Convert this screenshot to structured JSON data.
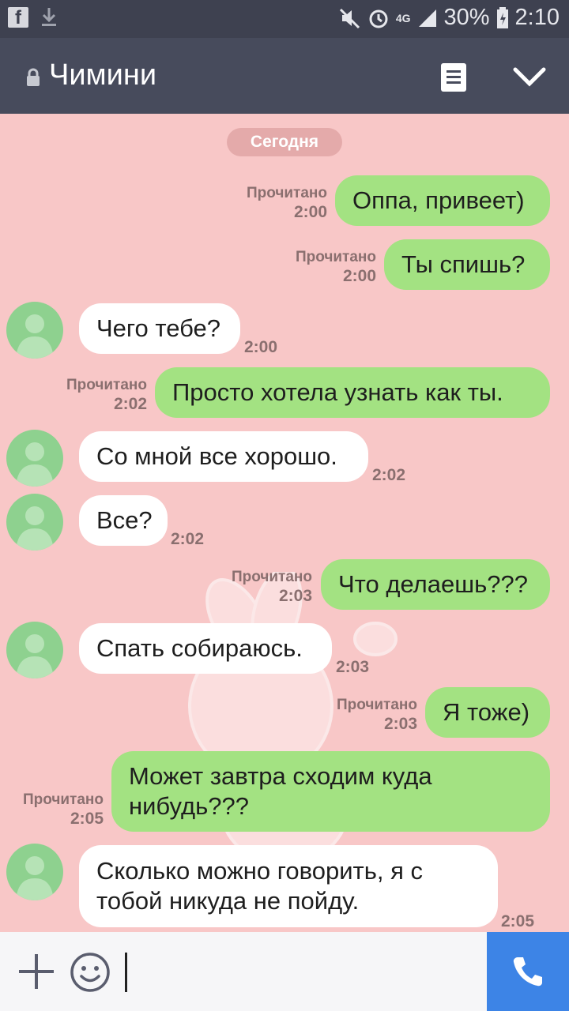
{
  "status_bar": {
    "battery_percent": "30%",
    "time": "2:10",
    "network": "4G",
    "left_icons": [
      "facebook-icon",
      "download-icon"
    ],
    "right_icons": [
      "mute-icon",
      "alarm-icon",
      "signal-icon",
      "battery-icon"
    ]
  },
  "header": {
    "title": "Чимини",
    "icons": [
      "lock-icon",
      "notes-icon",
      "chevron-down-icon"
    ]
  },
  "chat": {
    "date_separator": "Сегодня",
    "messages": [
      {
        "direction": "out",
        "text": "Оппа, привеет)",
        "status": "Прочитано",
        "time": "2:00"
      },
      {
        "direction": "out",
        "text": "Ты спишь?",
        "status": "Прочитано",
        "time": "2:00"
      },
      {
        "direction": "in",
        "text": "Чего тебе?",
        "time": "2:00"
      },
      {
        "direction": "out",
        "text": "Просто хотела узнать как ты.",
        "status": "Прочитано",
        "time": "2:02"
      },
      {
        "direction": "in",
        "text": "Со мной все хорошо.",
        "time": "2:02"
      },
      {
        "direction": "in",
        "text": "Все?",
        "time": "2:02"
      },
      {
        "direction": "out",
        "text": "Что делаешь???",
        "status": "Прочитано",
        "time": "2:03"
      },
      {
        "direction": "in",
        "text": "Спать собираюсь.",
        "time": "2:03"
      },
      {
        "direction": "out",
        "text": "Я тоже)",
        "status": "Прочитано",
        "time": "2:03"
      },
      {
        "direction": "out",
        "text": "Может завтра сходим куда нибудь???",
        "status": "Прочитано",
        "time": "2:05"
      },
      {
        "direction": "in",
        "text": "Сколько можно говорить, я с тобой никуда не пойду.",
        "time": "2:05"
      }
    ]
  },
  "input_bar": {
    "value": "",
    "icons": [
      "plus-icon",
      "emoji-icon",
      "phone-icon"
    ]
  },
  "colors": {
    "chat_background": "#f8c7c7",
    "outgoing_bubble": "#a3e282",
    "incoming_bubble": "#ffffff",
    "header": "#474b5c",
    "call_button": "#3d84e6"
  }
}
